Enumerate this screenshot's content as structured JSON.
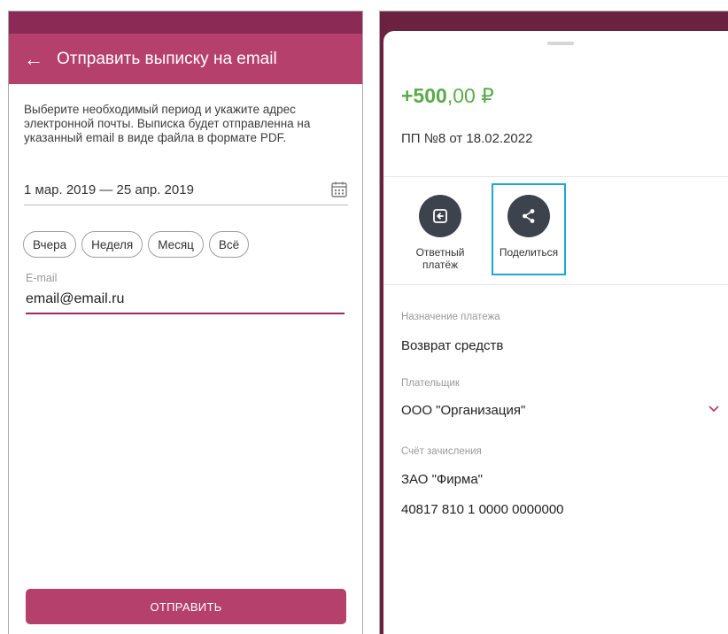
{
  "left": {
    "appbar": {
      "back_icon": "arrow-left-icon",
      "title": "Отправить выписку на email"
    },
    "description": "Выберите необходимый период и укажите адрес электронной почты. Выписка будет отправленна на указанный email в виде файла в формате PDF.",
    "period": {
      "value": "1 мар. 2019 — 25 апр. 2019",
      "icon": "calendar-icon"
    },
    "chips": [
      "Вчера",
      "Неделя",
      "Месяц",
      "Всё"
    ],
    "email": {
      "label": "E-mail",
      "value": "email@email.ru"
    },
    "send_label": "ОТПРАВИТЬ"
  },
  "right": {
    "amount": {
      "sign_int": "+500",
      "decimals": ",00 ₽"
    },
    "doc": "ПП №8 от 18.02.2022",
    "actions": [
      {
        "label_line1": "Ответный",
        "label_line2": "платёж",
        "icon": "return-payment-icon"
      },
      {
        "label": "Поделиться",
        "icon": "share-icon"
      }
    ],
    "fields": {
      "purpose_label": "Назначение платежа",
      "purpose_value": "Возврат средств",
      "payer_label": "Плательщик",
      "payer_value": "ООО \"Организация\"",
      "account_label": "Счёт зачисления",
      "account_name": "ЗАО \"Фирма\"",
      "account_number": "40817 810 1 0000 0000000"
    }
  },
  "colors": {
    "primary": "#b5406c",
    "status_bar": "#8a2a55",
    "positive_amount": "#5aab4b",
    "highlight": "#1ea6d6",
    "action_circle": "#3d434c"
  }
}
